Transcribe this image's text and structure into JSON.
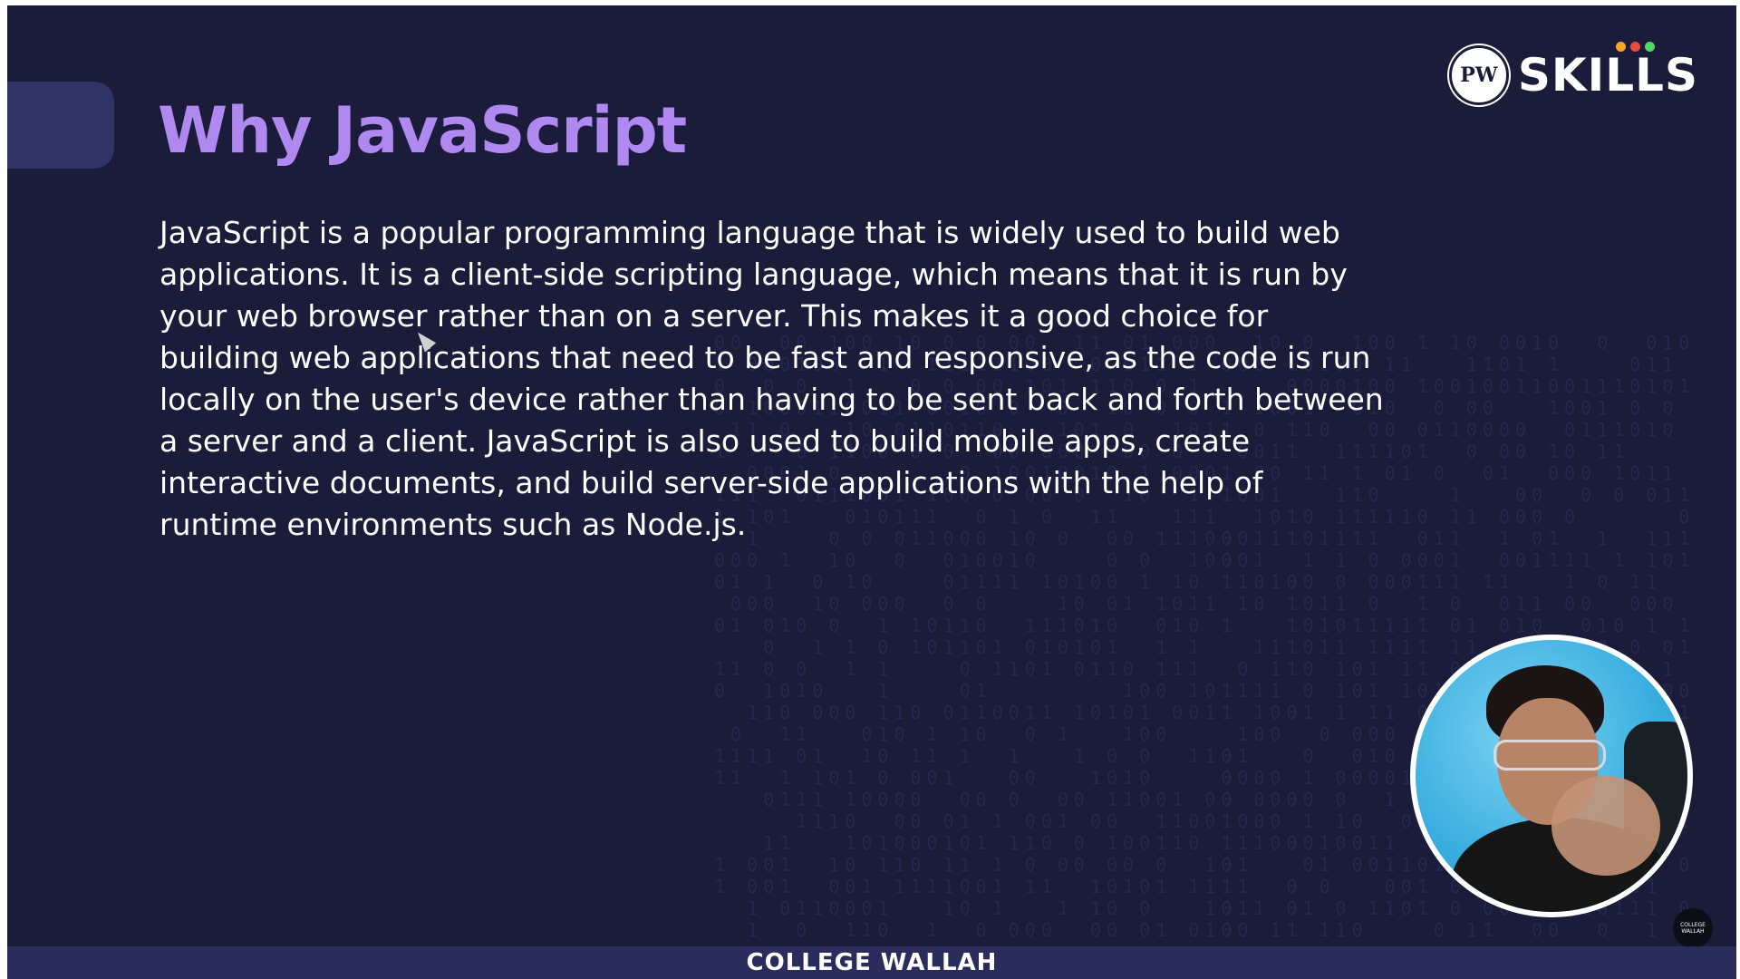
{
  "slide": {
    "title": "Why JavaScript",
    "body_lines": [
      "JavaScript is a popular programming language that is widely used to build web",
      "applications. It is a client-side scripting language, which means that it is run by",
      "your web browser rather than on a server. This makes it a good choice for",
      "building web applications that need to be fast and responsive, as the code is run",
      "locally on the user's device rather than having to be sent back and forth between",
      "a server and a client. JavaScript is also used to build mobile apps, create",
      "interactive documents, and build server-side applications with the help of",
      "runtime environments such as Node.js."
    ]
  },
  "logo": {
    "mark": "PW",
    "text": "SKILLS",
    "dot_colors": [
      "#f5a623",
      "#e84c3d",
      "#4cd964"
    ]
  },
  "footer": {
    "text": "COLLEGE WALLAH"
  },
  "channel_badge": {
    "text": "COLLEGE WALLAH"
  },
  "colors": {
    "background": "#1b1b3a",
    "title": "#b089f0",
    "accent_block": "#2f3465",
    "footer_bar": "#2a2d5c"
  },
  "icons": {
    "cursor": "pointer-cursor-icon",
    "logo": "pw-logo-icon"
  }
}
